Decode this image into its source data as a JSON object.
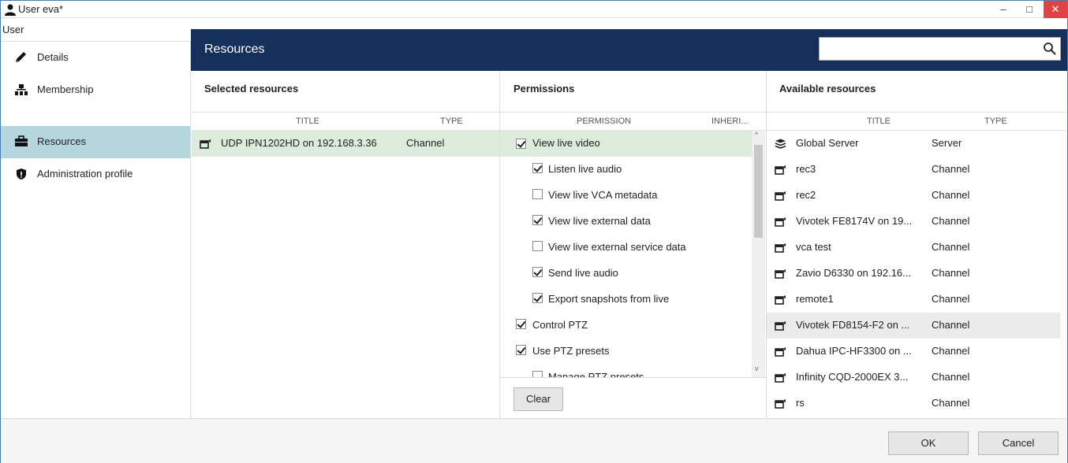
{
  "window": {
    "title": "User eva*",
    "minimize": "–",
    "maximize": "□",
    "close": "✕"
  },
  "nav": {
    "header": "User",
    "items": [
      {
        "label": "Details",
        "icon": "pencil-icon"
      },
      {
        "label": "Membership",
        "icon": "hierarchy-icon"
      },
      {
        "label": "Resources",
        "icon": "briefcase-icon",
        "active": true
      },
      {
        "label": "Administration profile",
        "icon": "shield-icon"
      }
    ]
  },
  "header": {
    "title": "Resources",
    "search_value": "",
    "band_color": "#14305b"
  },
  "selected": {
    "title": "Selected resources",
    "col_title": "TITLE",
    "col_type": "TYPE",
    "rows": [
      {
        "title": "UDP IPN1202HD on 192.168.3.36",
        "type": "Channel"
      }
    ]
  },
  "permissions": {
    "title": "Permissions",
    "col_permission": "PERMISSION",
    "col_inherited": "INHERI...",
    "rows": [
      {
        "label": "View live video",
        "checked": true,
        "indent": 0
      },
      {
        "label": "Listen live audio",
        "checked": true,
        "indent": 1
      },
      {
        "label": "View live VCA metadata",
        "checked": false,
        "indent": 1
      },
      {
        "label": "View live external data",
        "checked": true,
        "indent": 1
      },
      {
        "label": "View live external service data",
        "checked": false,
        "indent": 1
      },
      {
        "label": "Send live audio",
        "checked": true,
        "indent": 1
      },
      {
        "label": "Export snapshots from live",
        "checked": true,
        "indent": 1
      },
      {
        "label": "Control PTZ",
        "checked": true,
        "indent": 0
      },
      {
        "label": "Use PTZ presets",
        "checked": true,
        "indent": 0
      },
      {
        "label": "Manage PTZ presets",
        "checked": false,
        "indent": 1
      }
    ],
    "clear_label": "Clear"
  },
  "available": {
    "title": "Available resources",
    "col_title": "TITLE",
    "col_type": "TYPE",
    "rows": [
      {
        "title": "Global Server",
        "type": "Server",
        "icon": "server-icon"
      },
      {
        "title": "rec3",
        "type": "Channel",
        "icon": "camera-icon"
      },
      {
        "title": "rec2",
        "type": "Channel",
        "icon": "camera-icon"
      },
      {
        "title": "Vivotek FE8174V on 19...",
        "type": "Channel",
        "icon": "camera-icon"
      },
      {
        "title": "vca test",
        "type": "Channel",
        "icon": "camera-icon"
      },
      {
        "title": "Zavio D6330 on 192.16...",
        "type": "Channel",
        "icon": "camera-icon"
      },
      {
        "title": "remote1",
        "type": "Channel",
        "icon": "camera-icon"
      },
      {
        "title": "Vivotek FD8154-F2 on ...",
        "type": "Channel",
        "icon": "camera-icon",
        "hover": true
      },
      {
        "title": "Dahua IPC-HF3300 on ...",
        "type": "Channel",
        "icon": "camera-icon"
      },
      {
        "title": "Infinity CQD-2000EX 3...",
        "type": "Channel",
        "icon": "camera-icon"
      },
      {
        "title": "rs",
        "type": "Channel",
        "icon": "camera-icon"
      }
    ]
  },
  "footer": {
    "ok_label": "OK",
    "cancel_label": "Cancel"
  },
  "colors": {
    "selected_row": "#dcebdc",
    "nav_active": "#b5d5df",
    "hover_row": "#ebebeb"
  }
}
